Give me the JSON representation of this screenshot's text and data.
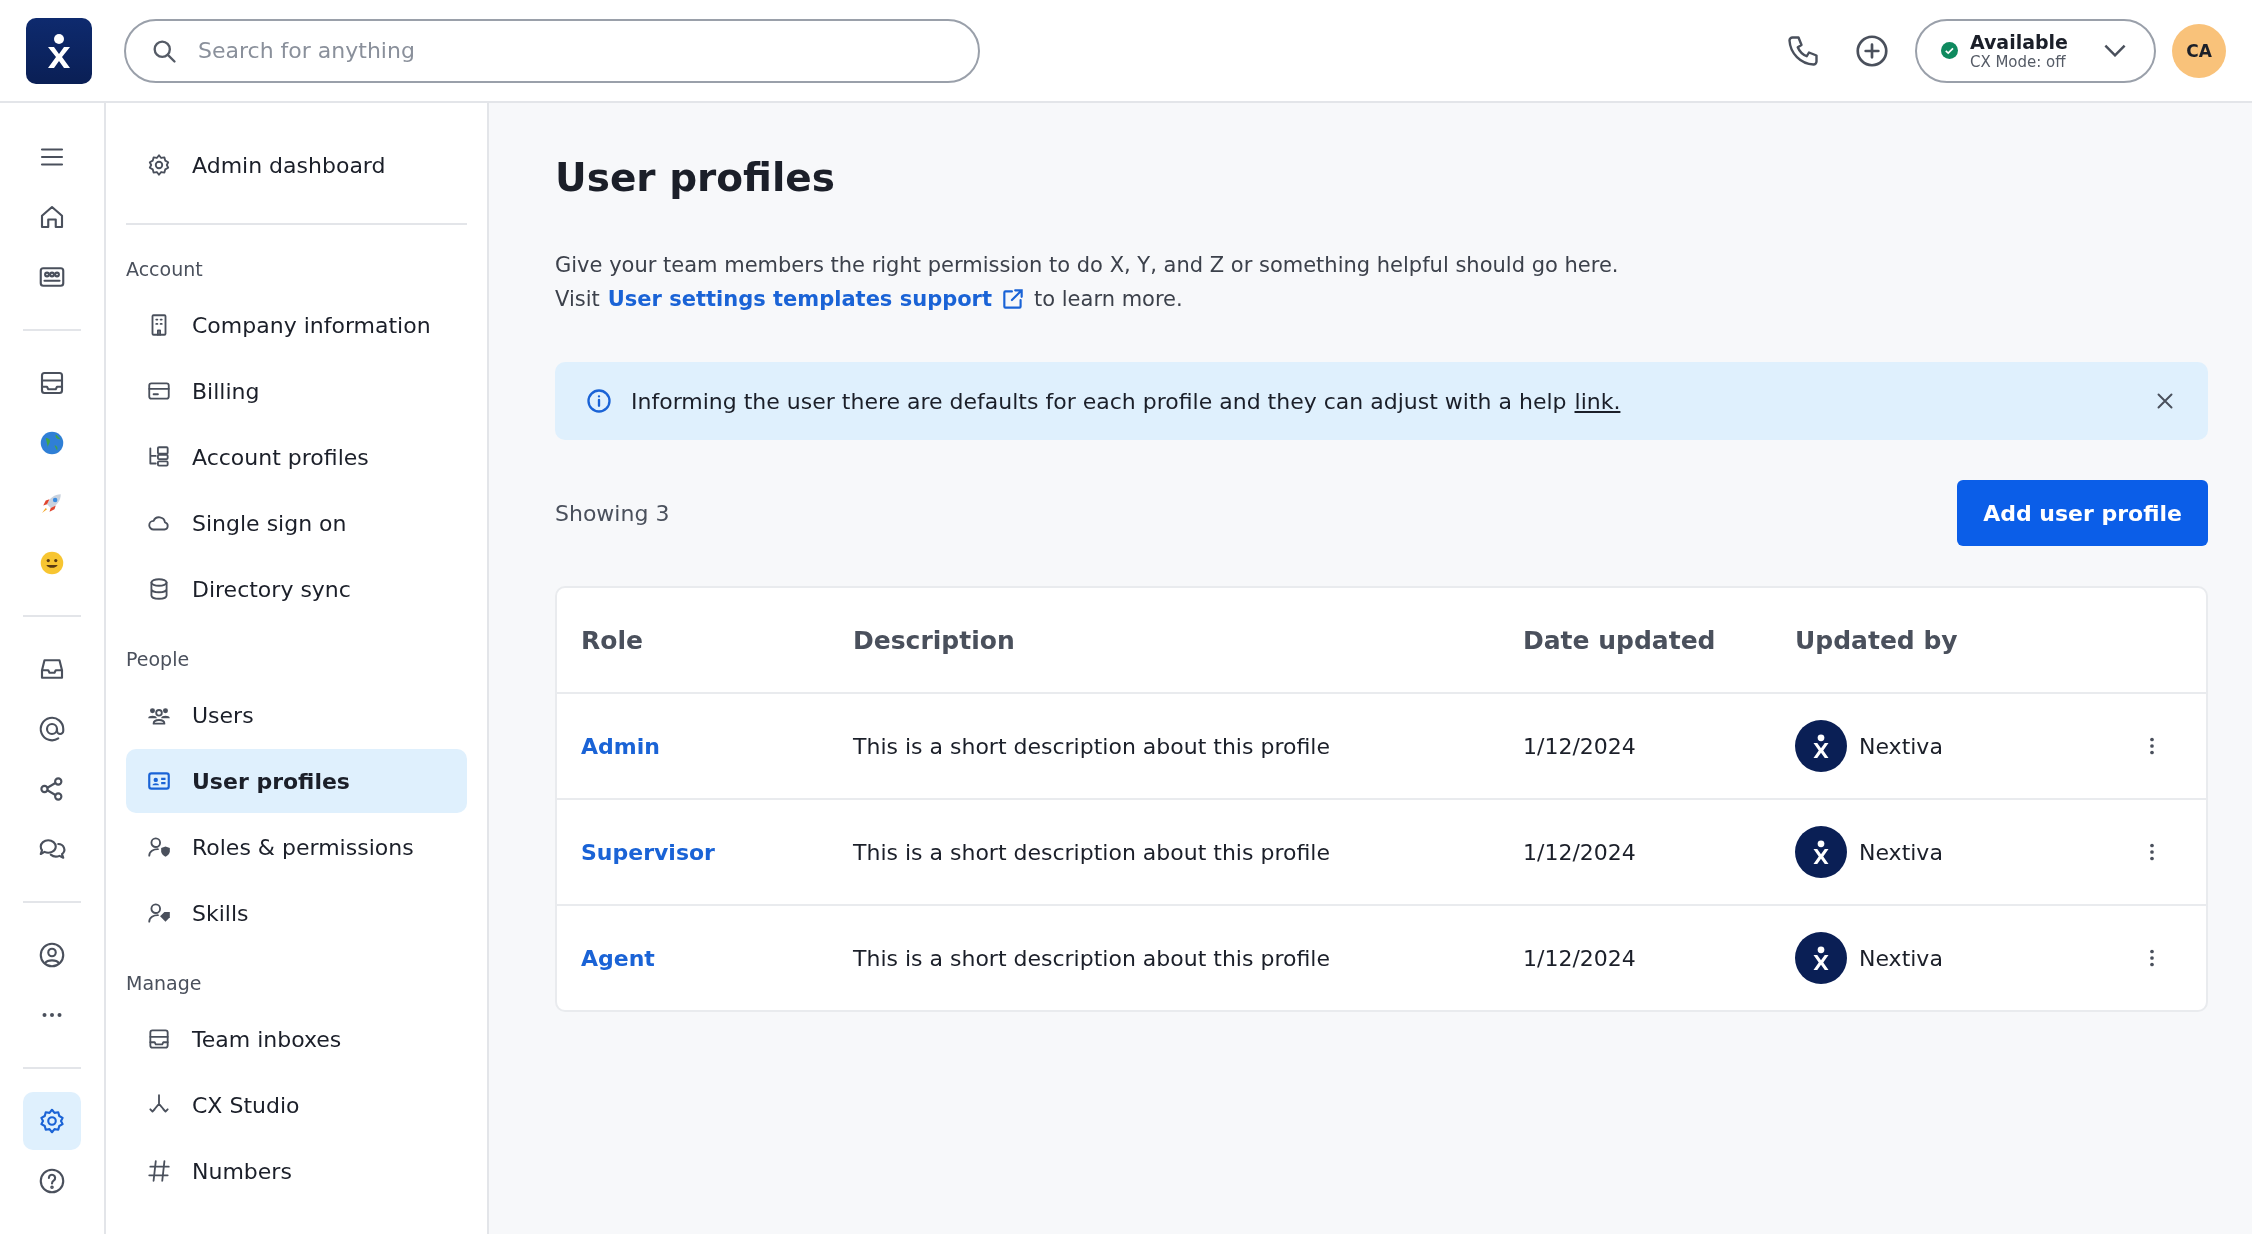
{
  "header": {
    "search": {
      "placeholder": "Search for anything"
    },
    "status": {
      "label": "Available",
      "sub": "CX Mode: off",
      "available": true
    },
    "avatar": "CA"
  },
  "rail": {
    "groups": [
      [
        {
          "kind": "menu",
          "selected": false
        },
        {
          "kind": "home",
          "selected": false
        },
        {
          "kind": "contacts",
          "selected": false
        }
      ],
      [
        {
          "kind": "inbox-stack",
          "selected": false
        },
        {
          "kind": "globe",
          "selected": false
        },
        {
          "kind": "rocket",
          "selected": false
        },
        {
          "kind": "smiley",
          "selected": false
        }
      ],
      [
        {
          "kind": "inbox",
          "selected": false
        },
        {
          "kind": "at",
          "selected": false
        },
        {
          "kind": "share",
          "selected": false
        },
        {
          "kind": "chat",
          "selected": false
        }
      ],
      [
        {
          "kind": "user-circle",
          "selected": false
        },
        {
          "kind": "more",
          "selected": false
        }
      ],
      [
        {
          "kind": "settings",
          "selected": true
        },
        {
          "kind": "help",
          "selected": false
        }
      ]
    ]
  },
  "sidebar": {
    "top": {
      "label": "Admin dashboard",
      "kind": "gear",
      "selected": false
    },
    "sections": [
      {
        "title": "Account",
        "items": [
          {
            "label": "Company information",
            "kind": "building",
            "selected": false
          },
          {
            "label": "Billing",
            "kind": "card",
            "selected": false
          },
          {
            "label": "Account profiles",
            "kind": "tree",
            "selected": false
          },
          {
            "label": "Single sign on",
            "kind": "cloud",
            "selected": false
          },
          {
            "label": "Directory sync",
            "kind": "database",
            "selected": false
          }
        ]
      },
      {
        "title": "People",
        "items": [
          {
            "label": "Users",
            "kind": "users",
            "selected": false
          },
          {
            "label": "User profiles",
            "kind": "id-card",
            "selected": true
          },
          {
            "label": "Roles & permissions",
            "kind": "user-shield",
            "selected": false
          },
          {
            "label": "Skills",
            "kind": "user-tag",
            "selected": false
          }
        ]
      },
      {
        "title": "Manage",
        "items": [
          {
            "label": "Team inboxes",
            "kind": "inbox-stack",
            "selected": false
          },
          {
            "label": "CX Studio",
            "kind": "branch",
            "selected": false
          },
          {
            "label": "Numbers",
            "kind": "hash",
            "selected": false
          }
        ]
      }
    ]
  },
  "page": {
    "title": "User profiles",
    "intro": "Give your team members the right permission to do X, Y, and Z or something helpful should go here.",
    "visit": "Visit",
    "visit_link": "User settings templates support",
    "visit_suffix": "to learn more.",
    "alert": {
      "text": "Informing the user there are defaults for each profile and they can adjust with a help",
      "link": "link."
    },
    "showing": "Showing 3",
    "add_button": "Add user profile",
    "table": {
      "columns": [
        "Role",
        "Description",
        "Date updated",
        "Updated by"
      ],
      "rows": [
        {
          "role": "Admin",
          "description": "This is a short description about this profile",
          "date": "1/12/2024",
          "updated_by": "Nextiva"
        },
        {
          "role": "Supervisor",
          "description": "This is a short description about this profile",
          "date": "1/12/2024",
          "updated_by": "Nextiva"
        },
        {
          "role": "Agent",
          "description": "This is a short description about this profile",
          "date": "1/12/2024",
          "updated_by": "Nextiva"
        }
      ]
    }
  }
}
